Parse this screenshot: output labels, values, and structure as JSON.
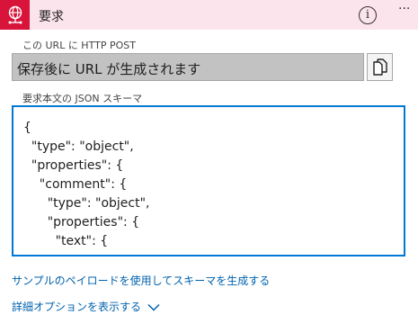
{
  "header": {
    "title": "要求",
    "accent_color": "#d8143a",
    "background_color": "#fce4ec",
    "trigger_icon": "globe-request-icon",
    "info_icon_glyph": "i",
    "more_icon_glyph": "···"
  },
  "url_section": {
    "label": "この URL に HTTP POST",
    "value": "保存後に URL が生成されます",
    "copy_icon": "copy-icon"
  },
  "schema_section": {
    "label": "要求本文の JSON スキーマ",
    "content": "{\n  \"type\": \"object\",\n  \"properties\": {\n    \"comment\": {\n      \"type\": \"object\",\n      \"properties\": {\n        \"text\": {",
    "border_color": "#0078d4"
  },
  "links": {
    "generate_schema": "サンプルのペイロードを使用してスキーマを生成する",
    "advanced_options": "詳細オプションを表示する",
    "link_color": "#0062ad"
  }
}
